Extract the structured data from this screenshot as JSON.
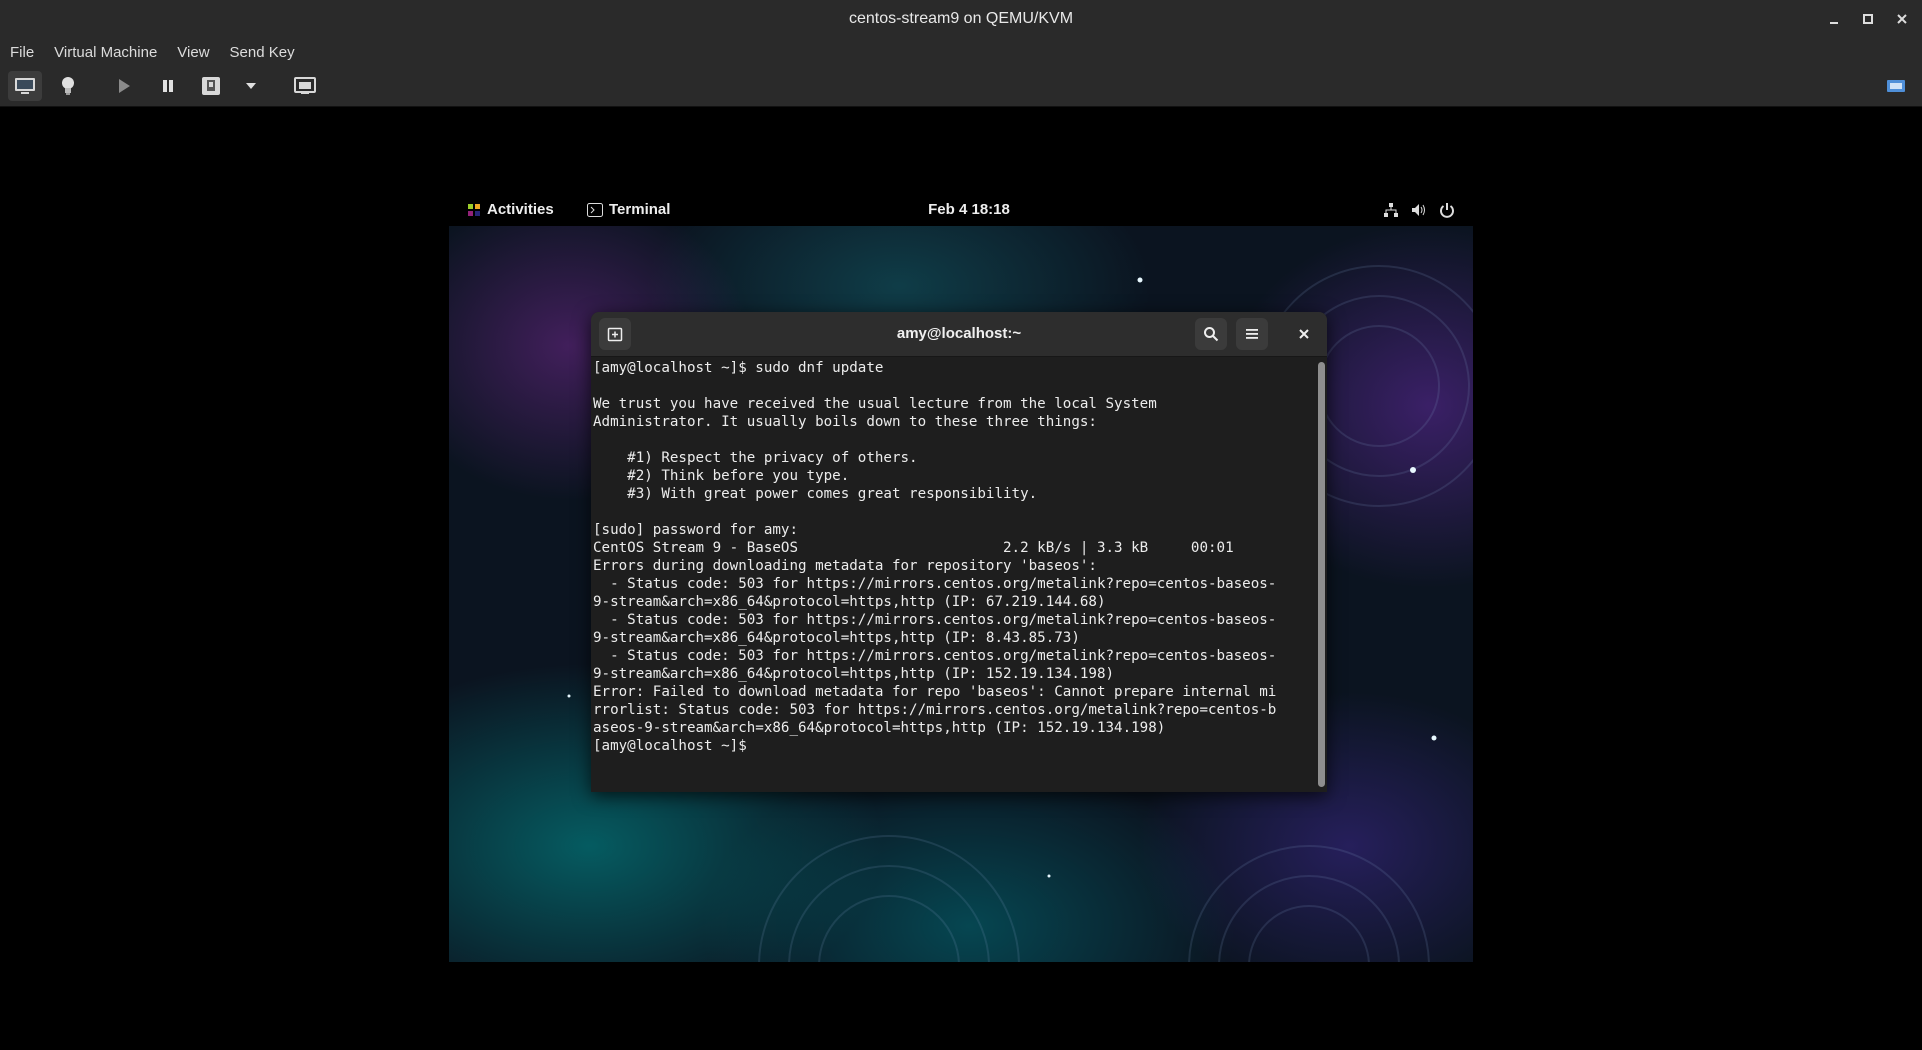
{
  "window": {
    "title": "centos-stream9 on QEMU/KVM"
  },
  "menu": {
    "file": "File",
    "virtual_machine": "Virtual Machine",
    "view": "View",
    "send_key": "Send Key"
  },
  "toolbar": {
    "buttons": [
      "monitor-icon",
      "lightbulb-icon",
      "play-icon",
      "pause-icon",
      "shutdown-icon",
      "dropdown-arrow-icon",
      "snapshots-icon",
      "fullscreen-icon"
    ]
  },
  "gnome": {
    "activities": "Activities",
    "app": "Terminal",
    "clock": "Feb 4  18:18"
  },
  "terminal": {
    "title": "amy@localhost:~",
    "lines": [
      "[amy@localhost ~]$ sudo dnf update",
      "",
      "We trust you have received the usual lecture from the local System",
      "Administrator. It usually boils down to these three things:",
      "",
      "    #1) Respect the privacy of others.",
      "    #2) Think before you type.",
      "    #3) With great power comes great responsibility.",
      "",
      "[sudo] password for amy:",
      "CentOS Stream 9 - BaseOS                        2.2 kB/s | 3.3 kB     00:01",
      "Errors during downloading metadata for repository 'baseos':",
      "  - Status code: 503 for https://mirrors.centos.org/metalink?repo=centos-baseos-",
      "9-stream&arch=x86_64&protocol=https,http (IP: 67.219.144.68)",
      "  - Status code: 503 for https://mirrors.centos.org/metalink?repo=centos-baseos-",
      "9-stream&arch=x86_64&protocol=https,http (IP: 8.43.85.73)",
      "  - Status code: 503 for https://mirrors.centos.org/metalink?repo=centos-baseos-",
      "9-stream&arch=x86_64&protocol=https,http (IP: 152.19.134.198)",
      "Error: Failed to download metadata for repo 'baseos': Cannot prepare internal mi",
      "rrorlist: Status code: 503 for https://mirrors.centos.org/metalink?repo=centos-b",
      "aseos-9-stream&arch=x86_64&protocol=https,http (IP: 152.19.134.198)",
      "[amy@localhost ~]$ "
    ]
  }
}
